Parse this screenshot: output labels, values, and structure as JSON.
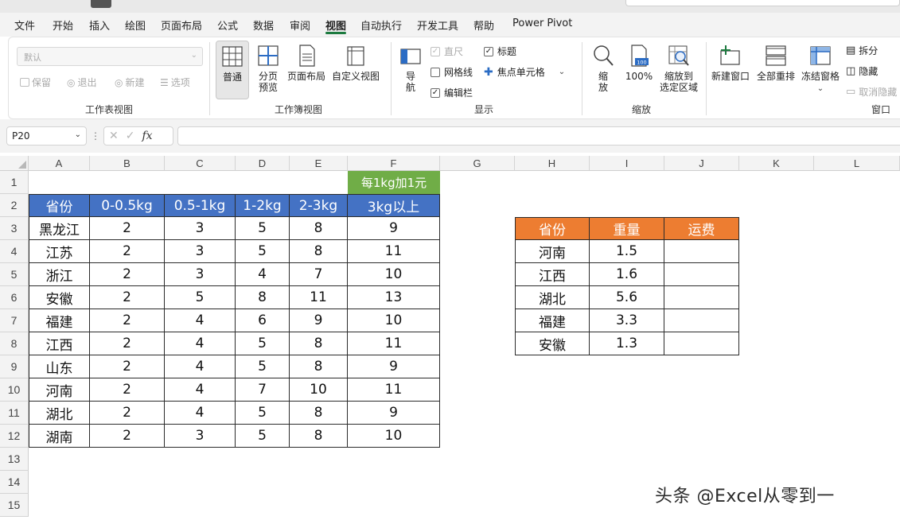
{
  "menu": {
    "tabs": [
      "文件",
      "开始",
      "插入",
      "绘图",
      "页面布局",
      "公式",
      "数据",
      "审阅",
      "视图",
      "自动执行",
      "开发工具",
      "帮助",
      "Power Pivot"
    ],
    "active_tab": "视图"
  },
  "ribbon": {
    "sheet_view": {
      "select_value": "默认",
      "keep_label": "保留",
      "exit_label": "退出",
      "new_label": "新建",
      "options_label": "选项",
      "group_label": "工作表视图"
    },
    "workbook_views": {
      "normal_label": "普通",
      "page_break_label": "分页\n预览",
      "page_layout_label": "页面布局",
      "custom_views_label": "自定义视图",
      "group_label": "工作簿视图"
    },
    "show": {
      "navigation_label": "导\n航",
      "ruler_label": "直尺",
      "gridlines_label": "网格线",
      "formula_bar_label": "编辑栏",
      "headings_label": "标题",
      "focus_cell_label": "焦点单元格",
      "group_label": "显示"
    },
    "zoom": {
      "zoom_label": "缩\n放",
      "zoom_100_label": "100%",
      "zoom_selection_label": "缩放到\n选定区域",
      "group_label": "缩放"
    },
    "window": {
      "new_window_label": "新建窗口",
      "arrange_all_label": "全部重排",
      "freeze_panes_label": "冻结窗格",
      "split_label": "拆分",
      "hide_label": "隐藏",
      "unhide_label": "取消隐藏",
      "group_label": "窗口"
    }
  },
  "formula_bar": {
    "name_box": "P20",
    "fx_label": "fx",
    "formula": ""
  },
  "grid": {
    "columns": [
      "A",
      "B",
      "C",
      "D",
      "E",
      "F",
      "G",
      "H",
      "I",
      "J",
      "K",
      "L"
    ],
    "rows": [
      "1",
      "2",
      "3",
      "4",
      "5",
      "6",
      "7",
      "8",
      "9",
      "10",
      "11",
      "12",
      "13",
      "14",
      "15"
    ]
  },
  "rate_table": {
    "note": "每1kg加1元",
    "headers": [
      "省份",
      "0-0.5kg",
      "0.5-1kg",
      "1-2kg",
      "2-3kg",
      "3kg以上"
    ],
    "rows": [
      [
        "黑龙江",
        "2",
        "3",
        "5",
        "8",
        "9"
      ],
      [
        "江苏",
        "2",
        "3",
        "5",
        "8",
        "11"
      ],
      [
        "浙江",
        "2",
        "3",
        "4",
        "7",
        "10"
      ],
      [
        "安徽",
        "2",
        "5",
        "8",
        "11",
        "13"
      ],
      [
        "福建",
        "2",
        "4",
        "6",
        "9",
        "10"
      ],
      [
        "江西",
        "2",
        "4",
        "5",
        "8",
        "11"
      ],
      [
        "山东",
        "2",
        "4",
        "5",
        "8",
        "9"
      ],
      [
        "河南",
        "2",
        "4",
        "7",
        "10",
        "11"
      ],
      [
        "湖北",
        "2",
        "4",
        "5",
        "8",
        "9"
      ],
      [
        "湖南",
        "2",
        "3",
        "5",
        "8",
        "10"
      ]
    ],
    "header_color": "#4472c4",
    "note_color": "#70ad47"
  },
  "lookup_table": {
    "headers": [
      "省份",
      "重量",
      "运费"
    ],
    "rows": [
      [
        "河南",
        "1.5",
        ""
      ],
      [
        "江西",
        "1.6",
        ""
      ],
      [
        "湖北",
        "5.6",
        ""
      ],
      [
        "福建",
        "3.3",
        ""
      ],
      [
        "安徽",
        "1.3",
        ""
      ]
    ],
    "header_color": "#ed7d31"
  },
  "watermark": "头条 @Excel从零到一"
}
